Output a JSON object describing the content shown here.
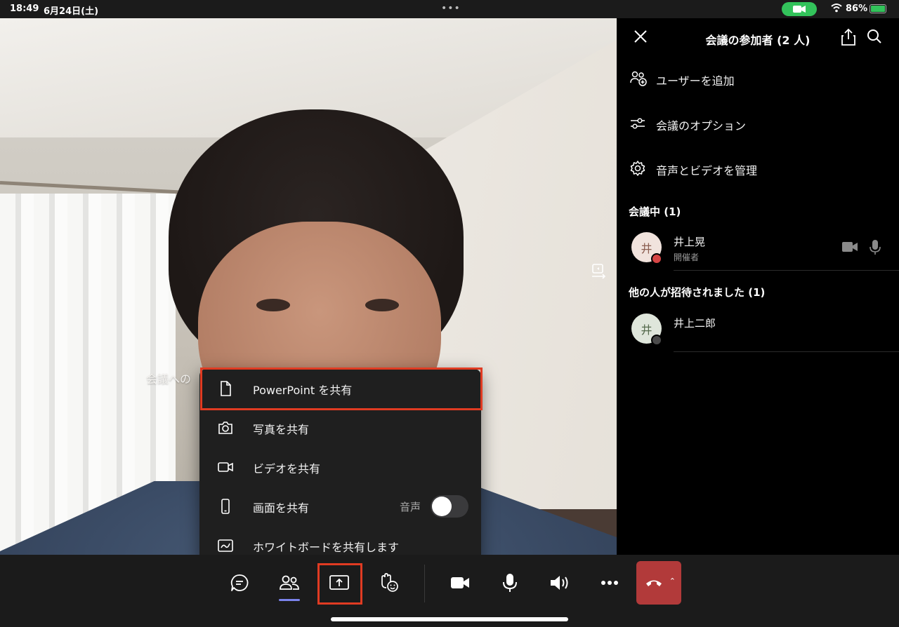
{
  "status_bar": {
    "time": "18:49",
    "date": "6月24日(土)",
    "dots": "•••",
    "battery_percent": "86%",
    "camera_pill_color": "#33c35b"
  },
  "video": {
    "hint_text": "会議への",
    "switch_camera_icon": "switch-camera-icon"
  },
  "share_menu": {
    "items": [
      {
        "label": "PowerPoint を共有",
        "icon": "file-icon"
      },
      {
        "label": "写真を共有",
        "icon": "camera-icon"
      },
      {
        "label": "ビデオを共有",
        "icon": "video-icon"
      },
      {
        "label": "画面を共有",
        "icon": "phone-icon"
      },
      {
        "label": "ホワイトボードを共有します",
        "icon": "whiteboard-icon"
      }
    ],
    "audio_label": "音声",
    "audio_toggle_on": false,
    "highlight_color": "#e03b22"
  },
  "panel": {
    "title": "会議の参加者 (2 人)",
    "actions": [
      {
        "label": "ユーザーを追加",
        "icon": "add-user-icon"
      },
      {
        "label": "会議のオプション",
        "icon": "sliders-icon"
      },
      {
        "label": "音声とビデオを管理",
        "icon": "gear-icon"
      }
    ],
    "sections": {
      "in_meeting": "会議中 (1)",
      "invited": "他の人が招待されました (1)"
    },
    "participants": [
      {
        "avatar": "井",
        "name": "井上晃",
        "role": "開催者",
        "avatar_bg": "#f1e3dd",
        "avatar_fg": "#8b5e50",
        "presence_color": "#d64545"
      },
      {
        "avatar": "井",
        "name": "井上二郎",
        "avatar_bg": "#dfe6db",
        "avatar_fg": "#566b4e",
        "presence_color": "#4a4a4a"
      }
    ]
  },
  "toolbar": {
    "buttons": [
      "chat-icon",
      "people-icon",
      "share-screen-icon",
      "raise-hand-icon",
      "video-icon",
      "mic-icon",
      "speaker-icon",
      "more-icon",
      "hangup-icon"
    ],
    "active_underline_color": "#7b83eb",
    "hangup_color": "#b23a3a"
  }
}
